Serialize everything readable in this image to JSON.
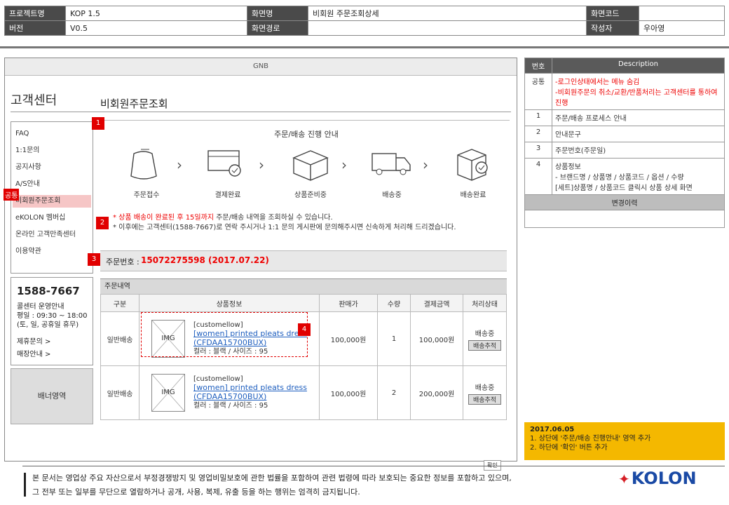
{
  "meta": {
    "project_label": "프로젝트명",
    "project_value": "KOP 1.5",
    "screen_label": "화면명",
    "screen_value": "비회원 주문조회상세",
    "code_label": "화면코드",
    "code_value": "",
    "version_label": "버전",
    "version_value": "V0.5",
    "path_label": "화면경로",
    "path_value": "",
    "author_label": "작성자",
    "author_value": "우아영"
  },
  "gnb": "GNB",
  "sidebar": {
    "title": "고객센터",
    "items": [
      "FAQ",
      "1:1문의",
      "공지사항",
      "A/S안내",
      "비회원주문조회",
      "eKOLON 멤버십",
      "온라인 고객만족센터",
      "이용약관"
    ],
    "common_tag": "공통"
  },
  "cs": {
    "phone": "1588-7667",
    "line1": "콜센터 운영안내",
    "line2": "평일 : 09:30 ~ 18:00",
    "line3": "(토, 일, 공휴일 휴무)",
    "link1": "제휴문의 >",
    "link2": "매장안내 >"
  },
  "banner": "배너영역",
  "page_title": "비회원주문조회",
  "guide": {
    "title": "주문/배송 진행 안내",
    "steps": [
      "주문접수",
      "결제완료",
      "상품준비중",
      "배송중",
      "배송완료"
    ],
    "notice1_red": "* 상품 배송이 완료된 후 15일까지",
    "notice1_rest": " 주문/배송 내역을 조회하실 수 있습니다.",
    "notice2": "* 이후에는 고객센터(1588-7667)로 연락 주시거나 1:1 문의 게시판에 문의해주시면 신속하게 처리해 드리겠습니다."
  },
  "order": {
    "label": "주문번호 : ",
    "value": "15072275598 (2017.07.22)"
  },
  "products": {
    "header": "주문내역",
    "columns": [
      "구분",
      "상품정보",
      "판매가",
      "수량",
      "결제금액",
      "처리상태"
    ],
    "rows": [
      {
        "type": "일반배송",
        "img": "IMG",
        "brand": "[customellow]",
        "name": "[women] printed pleats dress",
        "code": "(CFDAA15700BUX)",
        "option": "컬러 : 블랙 / 사이즈 : 95",
        "price": "100,000원",
        "qty": "1",
        "total": "100,000원",
        "status": "배송중",
        "status_btn": "배송추적"
      },
      {
        "type": "일반배송",
        "img": "IMG",
        "brand": "[customellow]",
        "name": "[women] printed pleats dress",
        "code": "(CFDAA15700BUX)",
        "option": "컬러 : 블랙 / 사이즈 : 95",
        "price": "100,000원",
        "qty": "2",
        "total": "200,000원",
        "status": "배송중",
        "status_btn": "배송추적"
      }
    ]
  },
  "markers": [
    "1",
    "2",
    "3",
    "4"
  ],
  "desc": {
    "head_no": "번호",
    "head_desc": "Description",
    "rows": [
      {
        "no": "공통",
        "text1": "-로그인상태에서는 메뉴 숨김",
        "text2": "-비회원주문의 취소/교환/반품처리는 고객센터를 통하여 진행"
      },
      {
        "no": "1",
        "text1": "주문/배송 프로세스 안내",
        "text2": ""
      },
      {
        "no": "2",
        "text1": "안내문구",
        "text2": ""
      },
      {
        "no": "3",
        "text1": "주문번호(주문일)",
        "text2": ""
      },
      {
        "no": "4",
        "text1": "상품정보",
        "text2": "- 브랜드명 / 상품명 / 상품코드 / 옵션 / 수량",
        "text3": "[세트]상품명 / 상품코드 클릭시 상품 상세 화면"
      }
    ],
    "sub_header": "변경이력"
  },
  "memo": {
    "date": "2017.06.05",
    "line1": "1. 상단에 '주문/배송 진행안내' 영역 추가",
    "line2": "2. 하단에 '확인' 버튼 추가"
  },
  "footer": {
    "line1": "본 문서는 영업상 주요 자산으로서 부정경쟁방지 및 영업비밀보호에 관한 법률을 포함하여 관련 법령에 따라 보호되는 중요한 정보를 포함하고 있으며,",
    "line2": "그 전부 또는 일부를 무단으로 열람하거나 공개, 사용, 복제, 유출 등을 하는 행위는 엄격히 금지됩니다.",
    "speech": "확인",
    "logo": "KOLON"
  },
  "colors": {
    "accent_red": "#e10000",
    "memo_yellow": "#f4b800",
    "link_blue": "#1f5fbf",
    "brand_blue": "#1a4aa5"
  }
}
